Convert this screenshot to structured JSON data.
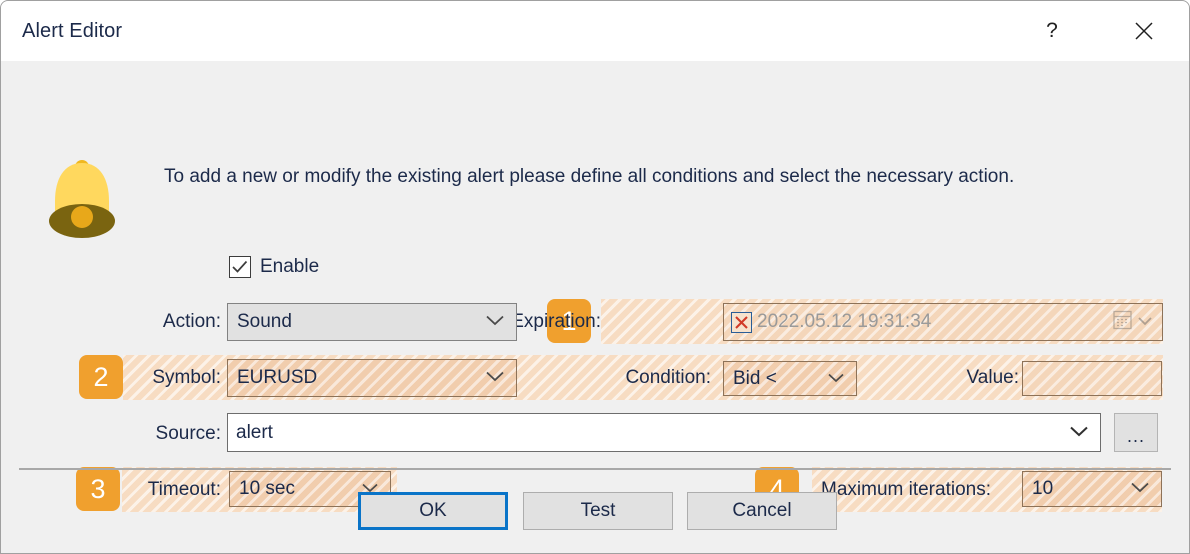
{
  "window": {
    "title": "Alert Editor",
    "help_label": "?",
    "help_icon": "question-mark-icon",
    "close_icon": "close-icon",
    "accent_color": "#0a74c8",
    "badge_color": "#f0a02e",
    "highlight_color": "#f7dcc2"
  },
  "header": {
    "bell_icon": "bell-icon",
    "instruction": "To add a new or modify the existing alert please define all conditions and select the necessary action."
  },
  "enable": {
    "label": "Enable",
    "checked": true,
    "check_icon": "checkmark-icon"
  },
  "badges": {
    "one": "1",
    "two": "2",
    "three": "3",
    "four": "4"
  },
  "fields": {
    "action": {
      "label": "Action:",
      "value": "Sound",
      "chevron_icon": "chevron-down-icon"
    },
    "expiration": {
      "label": "Expiration:",
      "value": "2022.05.12 19:31:34",
      "checkbox_icon": "red-x-icon",
      "checked": false,
      "calendar_icon": "calendar-icon",
      "chevron_icon": "chevron-down-icon"
    },
    "symbol": {
      "label": "Symbol:",
      "value": "EURUSD",
      "chevron_icon": "chevron-down-icon"
    },
    "condition": {
      "label": "Condition:",
      "value": "Bid <",
      "chevron_icon": "chevron-down-icon"
    },
    "value": {
      "label": "Value:",
      "value": "",
      "placeholder": ""
    },
    "source": {
      "label": "Source:",
      "value": "alert",
      "chevron_icon": "chevron-down-icon",
      "browse_label": "..."
    },
    "timeout": {
      "label": "Timeout:",
      "value": "10 sec",
      "chevron_icon": "chevron-down-icon"
    },
    "max_iterations": {
      "label": "Maximum iterations:",
      "value": "10",
      "chevron_icon": "chevron-down-icon"
    }
  },
  "footer": {
    "ok_label": "OK",
    "test_label": "Test",
    "cancel_label": "Cancel"
  }
}
